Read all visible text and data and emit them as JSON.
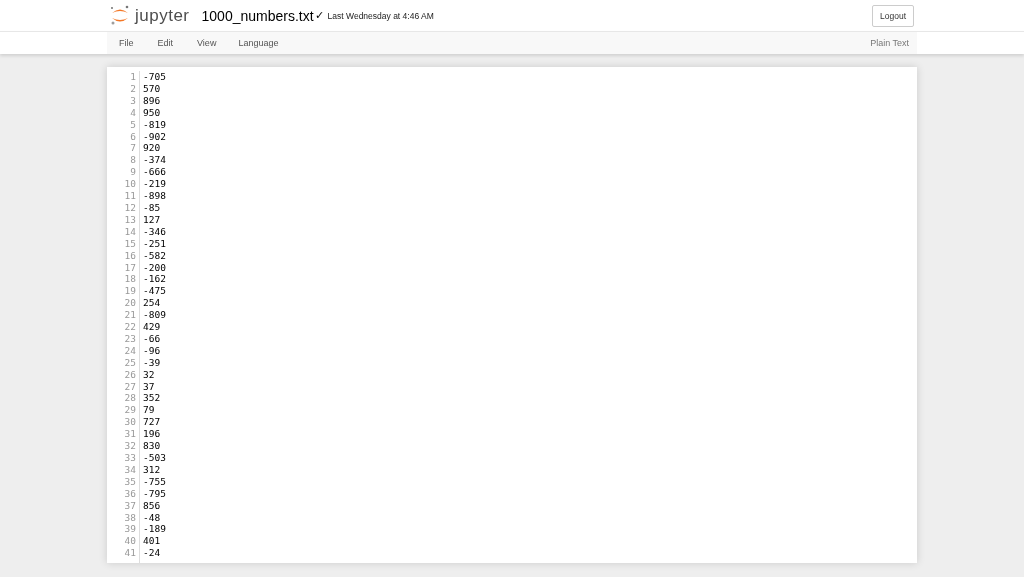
{
  "header": {
    "logo_text": "jupyter",
    "filename": "1000_numbers.txt",
    "saved_mark": "✓",
    "last_saved": "Last Wednesday at 4:46 AM",
    "logout": "Logout"
  },
  "menu": {
    "items": [
      "File",
      "Edit",
      "View",
      "Language"
    ],
    "mode": "Plain Text"
  },
  "editor": {
    "lines": [
      {
        "number": "1",
        "text": "-705"
      },
      {
        "number": "2",
        "text": "570"
      },
      {
        "number": "3",
        "text": "896"
      },
      {
        "number": "4",
        "text": "950"
      },
      {
        "number": "5",
        "text": "-819"
      },
      {
        "number": "6",
        "text": "-902"
      },
      {
        "number": "7",
        "text": "920"
      },
      {
        "number": "8",
        "text": "-374"
      },
      {
        "number": "9",
        "text": "-666"
      },
      {
        "number": "10",
        "text": "-219"
      },
      {
        "number": "11",
        "text": "-898"
      },
      {
        "number": "12",
        "text": "-85"
      },
      {
        "number": "13",
        "text": "127"
      },
      {
        "number": "14",
        "text": "-346"
      },
      {
        "number": "15",
        "text": "-251"
      },
      {
        "number": "16",
        "text": "-582"
      },
      {
        "number": "17",
        "text": "-200"
      },
      {
        "number": "18",
        "text": "-162"
      },
      {
        "number": "19",
        "text": "-475"
      },
      {
        "number": "20",
        "text": "254"
      },
      {
        "number": "21",
        "text": "-809"
      },
      {
        "number": "22",
        "text": "429"
      },
      {
        "number": "23",
        "text": "-66"
      },
      {
        "number": "24",
        "text": "-96"
      },
      {
        "number": "25",
        "text": "-39"
      },
      {
        "number": "26",
        "text": "32"
      },
      {
        "number": "27",
        "text": "37"
      },
      {
        "number": "28",
        "text": "352"
      },
      {
        "number": "29",
        "text": "79"
      },
      {
        "number": "30",
        "text": "727"
      },
      {
        "number": "31",
        "text": "196"
      },
      {
        "number": "32",
        "text": "830"
      },
      {
        "number": "33",
        "text": "-503"
      },
      {
        "number": "34",
        "text": "312"
      },
      {
        "number": "35",
        "text": "-755"
      },
      {
        "number": "36",
        "text": "-795"
      },
      {
        "number": "37",
        "text": "856"
      },
      {
        "number": "38",
        "text": "-48"
      },
      {
        "number": "39",
        "text": "-189"
      },
      {
        "number": "40",
        "text": "401"
      },
      {
        "number": "41",
        "text": "-24"
      }
    ]
  }
}
